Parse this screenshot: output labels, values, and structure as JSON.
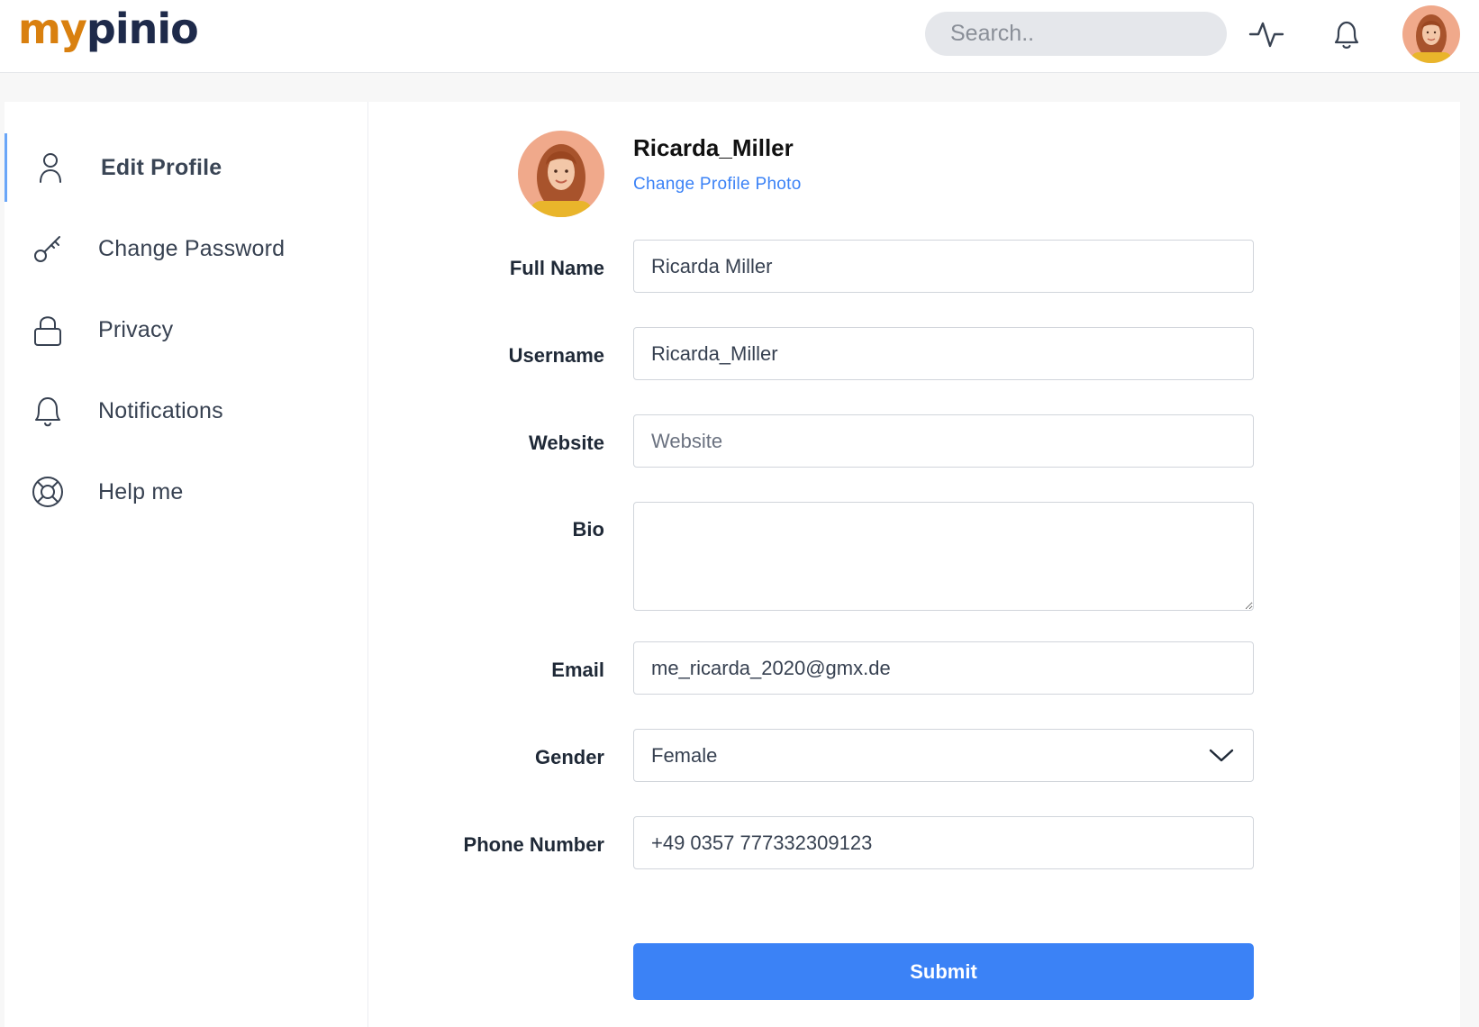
{
  "app": {
    "logo_part1": "my",
    "logo_part2": "pinio"
  },
  "header": {
    "search_placeholder": "Search..",
    "icons": [
      "activity-icon",
      "bell-icon",
      "avatar"
    ]
  },
  "sidebar": {
    "items": [
      {
        "label": "Edit Profile",
        "icon": "user-icon",
        "active": true
      },
      {
        "label": "Change Password",
        "icon": "key-icon",
        "active": false
      },
      {
        "label": "Privacy",
        "icon": "lock-icon",
        "active": false
      },
      {
        "label": "Notifications",
        "icon": "bell-icon",
        "active": false
      },
      {
        "label": "Help me",
        "icon": "lifebuoy-icon",
        "active": false
      }
    ]
  },
  "profile": {
    "username": "Ricarda_Miller",
    "change_photo_label": "Change Profile Photo"
  },
  "form": {
    "full_name": {
      "label": "Full Name",
      "value": "Ricarda Miller"
    },
    "username": {
      "label": "Username",
      "value": "Ricarda_Miller"
    },
    "website": {
      "label": "Website",
      "value": "",
      "placeholder": "Website"
    },
    "bio": {
      "label": "Bio",
      "value": ""
    },
    "email": {
      "label": "Email",
      "value": "me_ricarda_2020@gmx.de"
    },
    "gender": {
      "label": "Gender",
      "value": "Female"
    },
    "phone": {
      "label": "Phone Number",
      "value": "+49 0357 777332309123"
    },
    "submit_label": "Submit"
  },
  "colors": {
    "accent": "#3b82f6",
    "active_border": "#6aa6f8",
    "logo_orange": "#d9800f",
    "logo_navy": "#1e2a4a"
  }
}
